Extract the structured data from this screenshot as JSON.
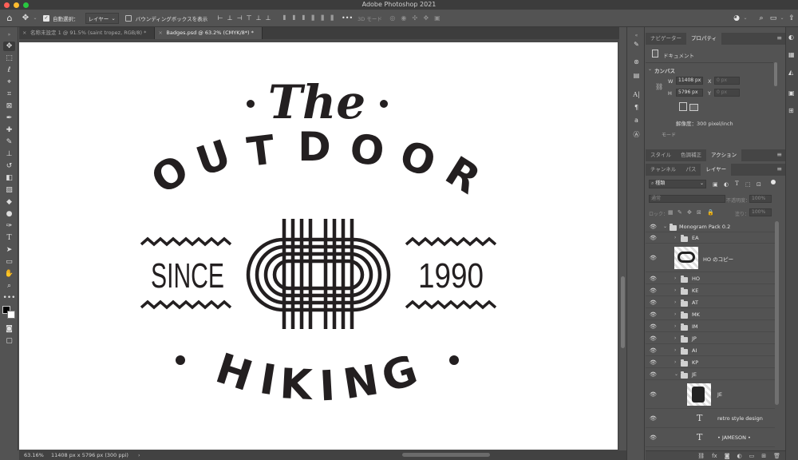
{
  "window": {
    "title": "Adobe Photoshop 2021"
  },
  "options_bar": {
    "auto_select_label": "自動選択：",
    "auto_select_value": "レイヤー",
    "bounding_box_label": "バウンディングボックスを表示",
    "mode_3d": "3D モード"
  },
  "doc_tabs": [
    {
      "label": "名称未設定 1 @ 91.5% (saint tropez, RGB/8) *"
    },
    {
      "label": "Badges.psd @ 63.2% (CMYK/8*) *"
    }
  ],
  "badge": {
    "the": "The",
    "outdoor_letters": [
      "O",
      "U",
      "T",
      "D",
      "O",
      "O",
      "R"
    ],
    "hiking_letters": [
      "H",
      "I",
      "K",
      "I",
      "N",
      "G"
    ],
    "since": "SINCE",
    "year": "1990"
  },
  "status": {
    "zoom": "63.16%",
    "doc_info": "11408 px x 5796 px (300 ppi)"
  },
  "properties_panel": {
    "tabs": [
      "ナビゲーター",
      "プロパティ"
    ],
    "document_label": "ドキュメント",
    "canvas_section": "カンバス",
    "w_label": "W",
    "w_value": "11408 px",
    "h_label": "H",
    "h_value": "5796 px",
    "x_label": "X",
    "x_value": "0 px",
    "y_label": "Y",
    "y_value": "0 px",
    "resolution": "解像度：300 pixel/inch",
    "mode_label": "モード"
  },
  "mid_panel": {
    "tabs": [
      "スタイル",
      "色調補正",
      "アクション"
    ]
  },
  "layers_panel": {
    "tabs": [
      "チャンネル",
      "パス",
      "レイヤー"
    ],
    "filter_kind": "種類",
    "blend_mode": "通常",
    "opacity_label": "不透明度：",
    "opacity_value": "100%",
    "lock_label": "ロック：",
    "fill_label": "塗り：",
    "fill_value": "100%",
    "layers": [
      {
        "name": "Monogram Pack 0.2",
        "kind": "group"
      },
      {
        "name": "EA",
        "kind": "group"
      },
      {
        "name": "HO のコピー",
        "kind": "smart"
      },
      {
        "name": "HO",
        "kind": "group"
      },
      {
        "name": "KE",
        "kind": "group"
      },
      {
        "name": "AT",
        "kind": "group"
      },
      {
        "name": "MK",
        "kind": "group"
      },
      {
        "name": "IM",
        "kind": "group"
      },
      {
        "name": "JP",
        "kind": "group"
      },
      {
        "name": "AI",
        "kind": "group"
      },
      {
        "name": "KP",
        "kind": "group"
      },
      {
        "name": "JE",
        "kind": "group"
      },
      {
        "name": "JE",
        "kind": "smart"
      },
      {
        "name": "retro style design",
        "kind": "text"
      },
      {
        "name": "• JAMESON •",
        "kind": "text"
      }
    ]
  },
  "colors": {
    "accent_blue": "#2d7bd8",
    "panel_bg": "#535353",
    "canvas_bg": "#ffffff",
    "ink": "#231f20"
  }
}
